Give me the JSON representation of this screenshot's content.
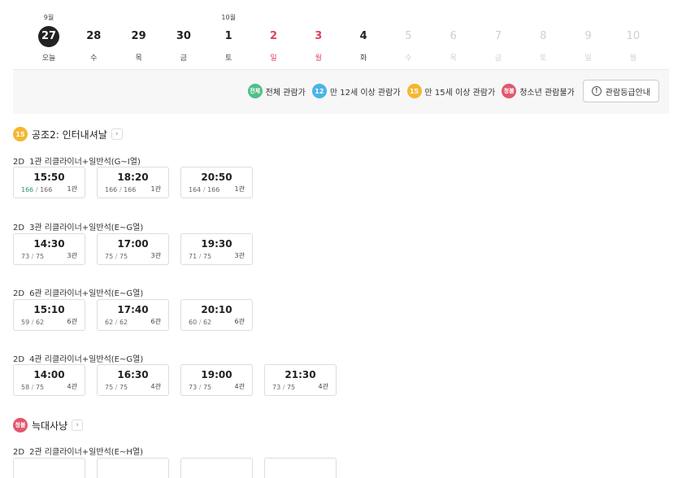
{
  "dates": {
    "months": [
      {
        "label": "9월",
        "col": 0
      },
      {
        "label": "10월",
        "col": 4
      }
    ],
    "days": [
      {
        "num": "27",
        "wd": "오늘",
        "state": "today"
      },
      {
        "num": "28",
        "wd": "수",
        "state": "normal"
      },
      {
        "num": "29",
        "wd": "목",
        "state": "normal"
      },
      {
        "num": "30",
        "wd": "금",
        "state": "normal"
      },
      {
        "num": "1",
        "wd": "토",
        "state": "normal"
      },
      {
        "num": "2",
        "wd": "일",
        "state": "holiday"
      },
      {
        "num": "3",
        "wd": "월",
        "state": "holiday"
      },
      {
        "num": "4",
        "wd": "화",
        "state": "normal"
      },
      {
        "num": "5",
        "wd": "수",
        "state": "disabled"
      },
      {
        "num": "6",
        "wd": "목",
        "state": "disabled"
      },
      {
        "num": "7",
        "wd": "금",
        "state": "disabled"
      },
      {
        "num": "8",
        "wd": "토",
        "state": "disabled"
      },
      {
        "num": "9",
        "wd": "일",
        "state": "disabled"
      },
      {
        "num": "10",
        "wd": "월",
        "state": "disabled"
      }
    ]
  },
  "legend": {
    "items": [
      {
        "badge": "전체",
        "label": "전체 관람가",
        "color": "#4fbf87"
      },
      {
        "badge": "12",
        "label": "만 12세 이상 관람가",
        "color": "#4ab4e6"
      },
      {
        "badge": "15",
        "label": "만 15세 이상 관람가",
        "color": "#f5b731"
      },
      {
        "badge": "청불",
        "label": "청소년 관람불가",
        "color": "#e2566e"
      }
    ],
    "guide_label": "관람등급안내",
    "guide_icon": "!"
  },
  "movies": [
    {
      "rating": "15",
      "rating_color": "#f5b731",
      "title": "공조2: 인터내셔날",
      "chevron": "›",
      "halls": [
        {
          "format": "2D",
          "name": "1관 리클라이너+일반석(G~I열)",
          "times": [
            {
              "time": "15:50",
              "avail": "166",
              "total": "166",
              "hall": "1관",
              "green": true
            },
            {
              "time": "18:20",
              "avail": "166",
              "total": "166",
              "hall": "1관",
              "green": false
            },
            {
              "time": "20:50",
              "avail": "164",
              "total": "166",
              "hall": "1관",
              "green": false
            }
          ]
        },
        {
          "format": "2D",
          "name": "3관 리클라이너+일반석(E~G열)",
          "times": [
            {
              "time": "14:30",
              "avail": "73",
              "total": "75",
              "hall": "3관",
              "green": false
            },
            {
              "time": "17:00",
              "avail": "75",
              "total": "75",
              "hall": "3관",
              "green": false
            },
            {
              "time": "19:30",
              "avail": "71",
              "total": "75",
              "hall": "3관",
              "green": false
            }
          ]
        },
        {
          "format": "2D",
          "name": "6관 리클라이너+일반석(E~G열)",
          "times": [
            {
              "time": "15:10",
              "avail": "59",
              "total": "62",
              "hall": "6관",
              "green": false
            },
            {
              "time": "17:40",
              "avail": "62",
              "total": "62",
              "hall": "6관",
              "green": false
            },
            {
              "time": "20:10",
              "avail": "60",
              "total": "62",
              "hall": "6관",
              "green": false
            }
          ]
        },
        {
          "format": "2D",
          "name": "4관 리클라이너+일반석(E~G열)",
          "times": [
            {
              "time": "14:00",
              "avail": "58",
              "total": "75",
              "hall": "4관",
              "green": false
            },
            {
              "time": "16:30",
              "avail": "75",
              "total": "75",
              "hall": "4관",
              "green": false
            },
            {
              "time": "19:00",
              "avail": "73",
              "total": "75",
              "hall": "4관",
              "green": false
            },
            {
              "time": "21:30",
              "avail": "73",
              "total": "75",
              "hall": "4관",
              "green": false
            }
          ]
        }
      ]
    },
    {
      "rating": "청불",
      "rating_color": "#e2566e",
      "title": "늑대사냥",
      "chevron": "›",
      "halls": [
        {
          "format": "2D",
          "name": "2관 리클라이너+일반석(E~H열)",
          "times": []
        }
      ]
    }
  ]
}
